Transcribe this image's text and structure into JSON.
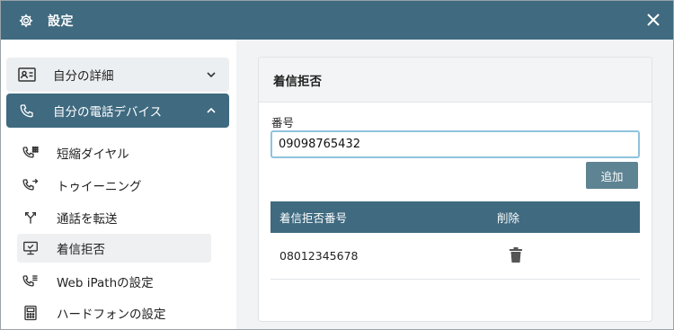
{
  "window": {
    "title": "設定",
    "icon": "gear-icon",
    "close_icon": "close-icon"
  },
  "sidebar": {
    "groups": [
      {
        "label": "自分の詳細",
        "icon": "contact-card-icon",
        "expanded": false
      },
      {
        "label": "自分の電話デバイス",
        "icon": "phone-icon",
        "expanded": true
      }
    ],
    "items": [
      {
        "label": "短縮ダイヤル",
        "icon": "phone-dialpad-icon"
      },
      {
        "label": "トゥイーニング",
        "icon": "phone-forward-icon"
      },
      {
        "label": "通話を転送",
        "icon": "call-split-icon"
      },
      {
        "label": "着信拒否",
        "icon": "monitor-icon",
        "active": true
      },
      {
        "label": "Web iPathの設定",
        "icon": "phone-dialpad-icon"
      },
      {
        "label": "ハードフォンの設定",
        "icon": "desk-phone-icon"
      }
    ]
  },
  "main": {
    "card_title": "着信拒否",
    "field_label": "番号",
    "input_value": "09098765432",
    "add_label": "追加",
    "table": {
      "headers": [
        "着信拒否番号",
        "削除"
      ],
      "rows": [
        {
          "number": "08012345678",
          "delete_icon": "trash-icon"
        }
      ]
    }
  },
  "colors": {
    "accent": "#3f6a80",
    "button": "#5e8392",
    "input_focus": "#8fc3dd"
  }
}
